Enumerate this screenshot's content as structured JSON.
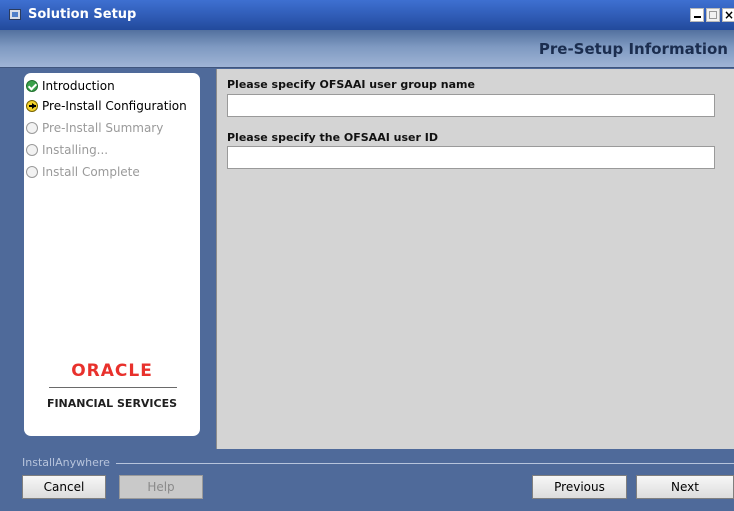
{
  "window": {
    "title": "Solution Setup",
    "close_glyph": "×"
  },
  "header": {
    "step_title": "Pre-Setup Information"
  },
  "steps": [
    {
      "label": "Introduction",
      "state": "done"
    },
    {
      "label": "Pre-Install Configuration",
      "state": "current"
    },
    {
      "label": "Pre-Install Summary",
      "state": "pending"
    },
    {
      "label": "Installing...",
      "state": "pending"
    },
    {
      "label": "Install Complete",
      "state": "pending"
    }
  ],
  "branding": {
    "oracle": "ORACLE",
    "tagline": "FINANCIAL SERVICES"
  },
  "form": {
    "group_label": "Please specify OFSAAI user group name",
    "group_value": "",
    "userid_label": "Please specify the OFSAAI user ID",
    "userid_value": ""
  },
  "footer": {
    "installer_name": "InstallAnywhere",
    "cancel": "Cancel",
    "help": "Help",
    "previous": "Previous",
    "next": "Next"
  },
  "colors": {
    "oracle_red": "#e8312c",
    "titlebar_blue": "#2f5bb5",
    "done_green": "#3aa14a",
    "current_yellow": "#f3d22a"
  }
}
